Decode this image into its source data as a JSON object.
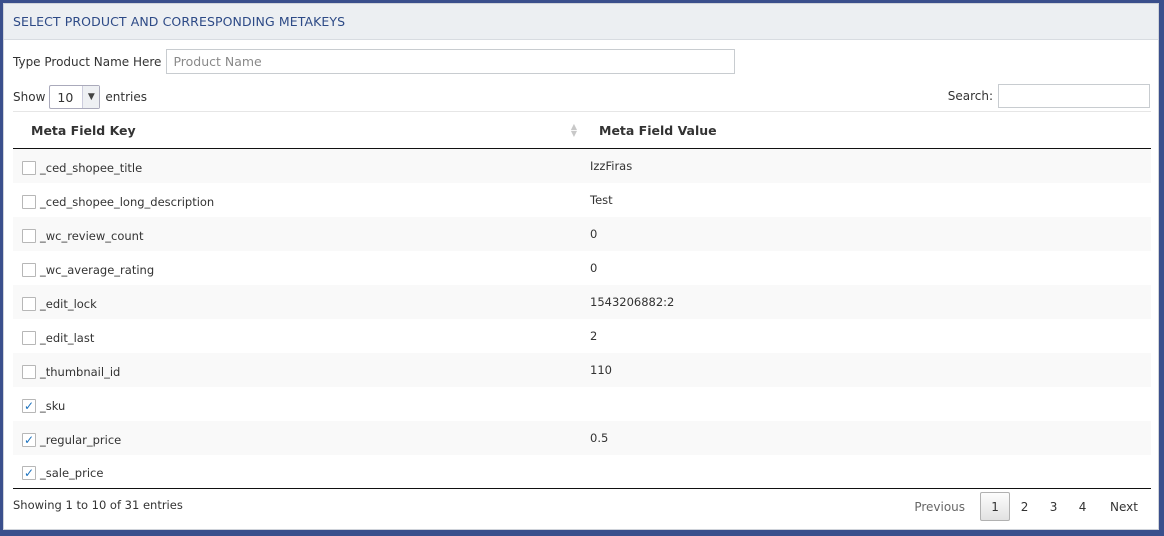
{
  "header": {
    "title": "SELECT PRODUCT AND CORRESPONDING METAKEYS"
  },
  "product": {
    "label": "Type Product Name Here",
    "placeholder": "Product Name"
  },
  "length": {
    "show_label": "Show",
    "selected": "10",
    "entries_label": "entries"
  },
  "search": {
    "label": "Search:"
  },
  "table": {
    "columns": [
      "Meta Field Key",
      "Meta Field Value"
    ],
    "rows": [
      {
        "key": "_ced_shopee_title",
        "value": "IzzFiras",
        "checked": false
      },
      {
        "key": "_ced_shopee_long_description",
        "value": "Test",
        "checked": false
      },
      {
        "key": "_wc_review_count",
        "value": "0",
        "checked": false
      },
      {
        "key": "_wc_average_rating",
        "value": "0",
        "checked": false
      },
      {
        "key": "_edit_lock",
        "value": "1543206882:2",
        "checked": false
      },
      {
        "key": "_edit_last",
        "value": "2",
        "checked": false
      },
      {
        "key": "_thumbnail_id",
        "value": "110",
        "checked": false
      },
      {
        "key": "_sku",
        "value": "",
        "checked": true
      },
      {
        "key": "_regular_price",
        "value": "0.5",
        "checked": true
      },
      {
        "key": "_sale_price",
        "value": "",
        "checked": true
      }
    ]
  },
  "footer": {
    "info": "Showing 1 to 10 of 31 entries",
    "previous": "Previous",
    "pages": [
      "1",
      "2",
      "3",
      "4"
    ],
    "next": "Next"
  }
}
